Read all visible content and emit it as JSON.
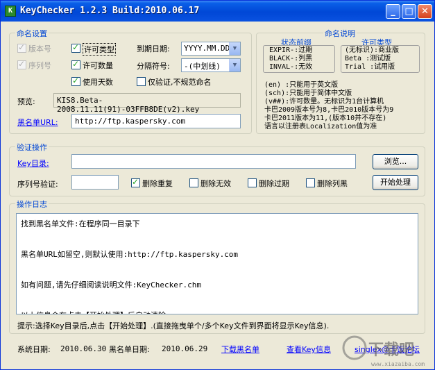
{
  "window": {
    "title": "KeyChecker 1.2.3 Build:2010.06.17",
    "icon_letter": "K",
    "buttons": {
      "minimize": "_",
      "maximize": "□",
      "close": "✕"
    }
  },
  "naming": {
    "group_title": "命名设置",
    "version_label": "版本号",
    "serial_label": "序列号",
    "license_type_label": "许可类型",
    "license_count_label": "许可数量",
    "days_label": "使用天数",
    "expiry_label": "到期日期:",
    "expiry_value": "YYYY.MM.DD",
    "separator_label": "分隔符号:",
    "separator_value": "-(中划线)",
    "verify_only_label": "仅验证,不规范命名",
    "preview_label": "预览:",
    "preview_value": "KIS8.Beta-2008.11.11(91)-03FFB8DE(v2).key",
    "blacklist_label": "黑名单URL:",
    "blacklist_value": "http://ftp.kaspersky.com",
    "checkboxes": {
      "version": {
        "checked": true,
        "disabled": true
      },
      "serial": {
        "checked": true,
        "disabled": true
      },
      "license_type": {
        "checked": true,
        "disabled": false
      },
      "license_count": {
        "checked": true,
        "disabled": false
      },
      "days": {
        "checked": true,
        "disabled": false
      },
      "verify_only": {
        "checked": false,
        "disabled": false
      }
    }
  },
  "naming_help": {
    "group_title": "命名说明",
    "status_title": "状态前缀",
    "status_lines": [
      "EXPIR-:过期",
      "BLACK-:列黑",
      "INVAL-:无效"
    ],
    "license_title": "许可类型",
    "license_lines": [
      "(无标识):商业版",
      "Beta  :测试版",
      "Trial :试用版"
    ],
    "notes": [
      "(en) :只能用于英文版",
      "(sch):只能用于简体中文版",
      "(v##):许可数量。无标识为1台计算机",
      "卡巴2009版本号为8,卡巴2010版本号为9",
      "卡巴2011版本为11,(版本10并不存在)",
      "语言以注册表Localization值为准"
    ]
  },
  "verify": {
    "group_title": "验证操作",
    "key_dir_label": "Key目录:",
    "key_dir_value": "",
    "browse_label": "浏览...",
    "serial_verify_label": "序列号验证:",
    "serial_verify_value": "",
    "options": [
      {
        "label": "删除重复",
        "checked": true
      },
      {
        "label": "删除无效",
        "checked": false
      },
      {
        "label": "删除过期",
        "checked": false
      },
      {
        "label": "删除列黑",
        "checked": false
      }
    ],
    "start_label": "开始处理"
  },
  "log": {
    "group_title": "操作日志",
    "lines": [
      "找到黑名单文件:在程序同一目录下",
      "",
      "黑名单URL如留空,则默认使用:http://ftp.kaspersky.com",
      "",
      "如有问题,请先仔细阅读说明文件:KeyChecker.chm",
      "",
      "以上信息会在点击【开始处理】后自动清除..."
    ],
    "hint": "提示:选择Key目录后,点击【开始处理】.(直接拖曳单个/多个Key文件到界面将显示Key信息)."
  },
  "status": {
    "system_date_label": "系统日期:",
    "system_date": "2010.06.30",
    "blacklist_date_label": "黑名单日期:",
    "blacklist_date": "2010.06.29",
    "download_link": "下载黑名单",
    "view_key_link": "查看Key信息",
    "forum_link": "singlex@卡饭论坛"
  },
  "watermark": {
    "text": "下载吧",
    "url_text": "www.xiazaiba.com"
  },
  "colors": {
    "accent": "#0046d5",
    "titlebar": "#0047d6",
    "face": "#ece9d8"
  }
}
